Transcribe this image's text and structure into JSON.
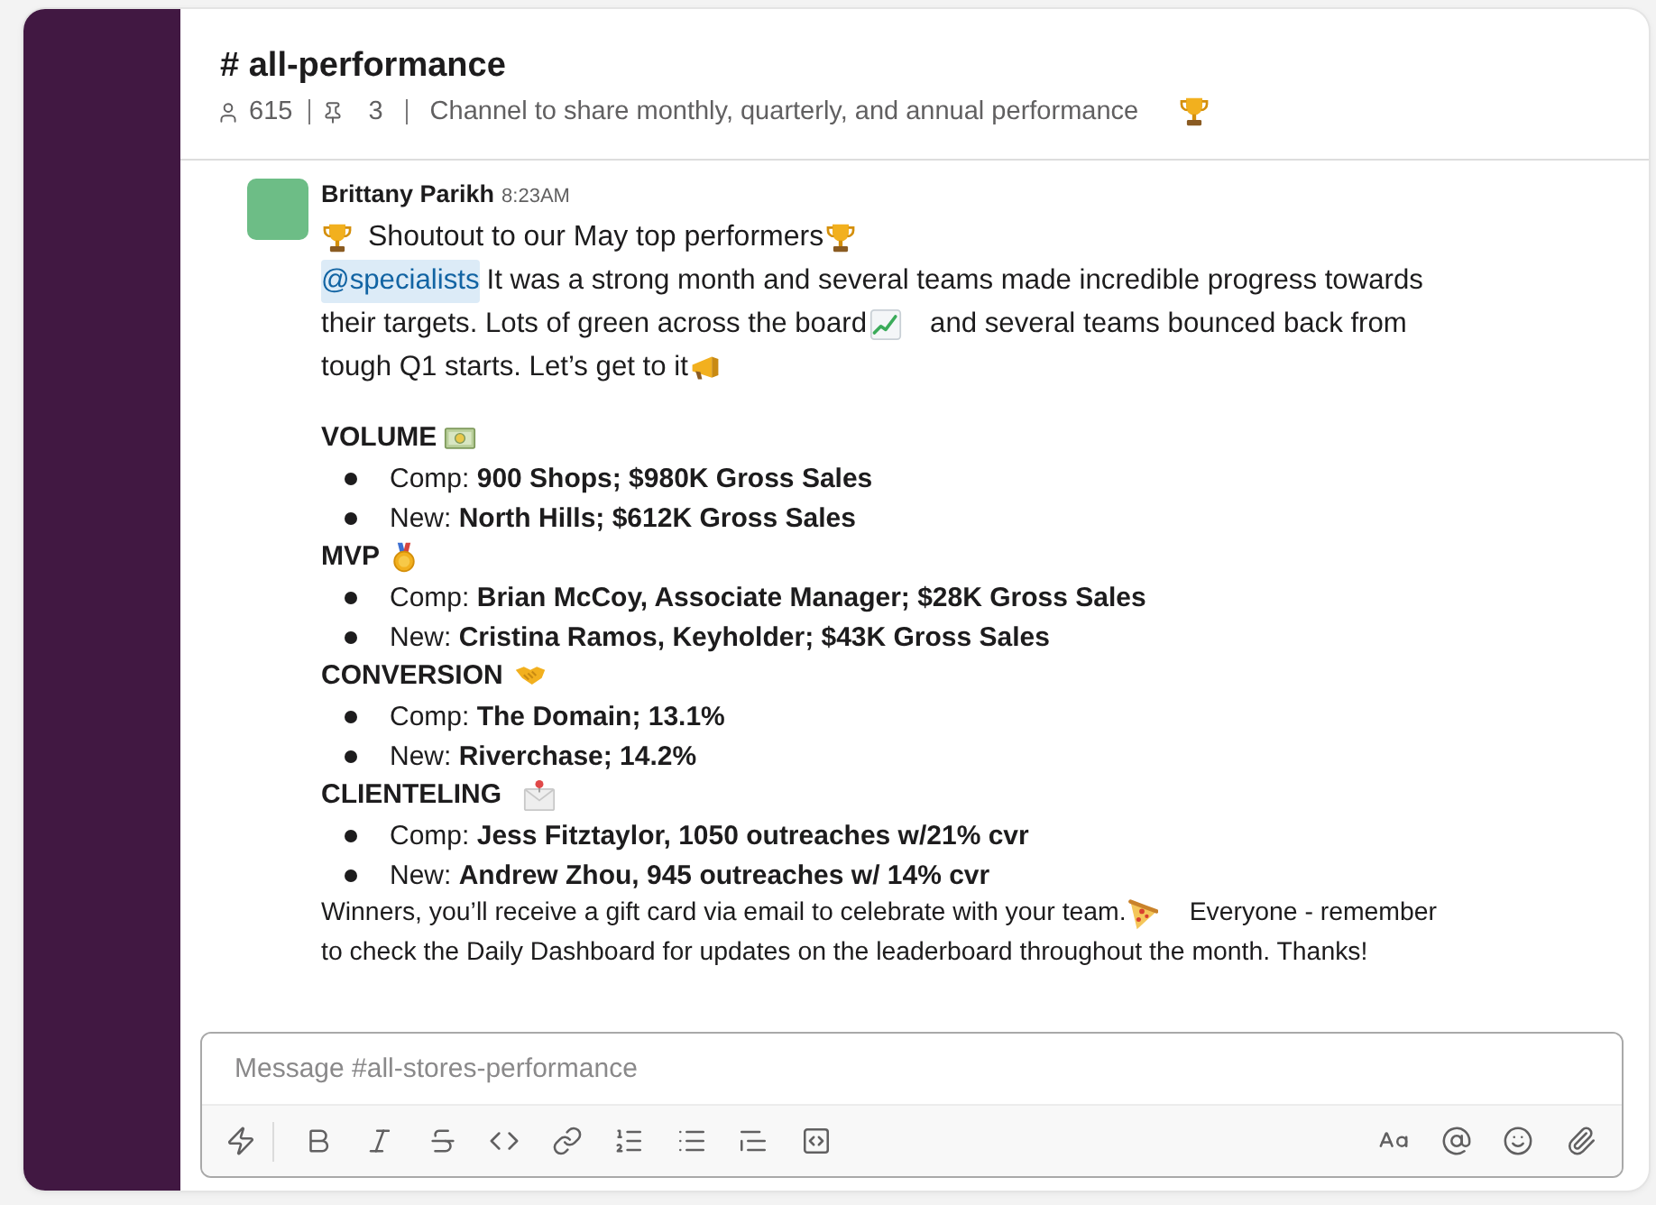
{
  "channel": {
    "title": "# all-performance",
    "members": "615",
    "pins": "3",
    "description": "Channel to share monthly, quarterly, and annual performance"
  },
  "message": {
    "author": "Brittany Parikh",
    "time": "8:23AM",
    "headline": "Shoutout to our May top performers",
    "intro": {
      "mention": "@specialists",
      "line_1": "It was a strong month and several teams made incredible progress towards",
      "line_2a": "their targets. Lots of green across the board",
      "line_2b": "and several teams bounced back from",
      "line_3": "tough Q1 starts. Let’s get to it"
    },
    "sections": [
      {
        "title": "VOLUME",
        "items": [
          "Comp: **900 Shops; $980K Gross Sales**",
          "New: **North Hills; $612K Gross Sales**"
        ]
      },
      {
        "title": "MVP",
        "items": [
          "Comp: **Brian McCoy, Associate Manager; $28K Gross Sales**",
          "New: **Cristina Ramos, Keyholder; $43K Gross Sales**"
        ]
      },
      {
        "title": "CONVERSION",
        "items": [
          "Comp: **The Domain; 13.1%**",
          "New: **Riverchase; 14.2%**"
        ]
      },
      {
        "title": "CLIENTELING",
        "items": [
          "Comp: **Jess Fitztaylor, 1050 outreaches w/21% cvr**",
          "New: **Andrew Zhou, 945 outreaches w/ 14% cvr**"
        ]
      }
    ],
    "closing": {
      "line_1a": "Winners, you’ll receive a gift card via email to celebrate with your team.",
      "line_1b": "Everyone - remember",
      "line_2": "to check the Daily Dashboard for updates on the leaderboard throughout the month. Thanks!"
    }
  },
  "composer": {
    "placeholder": "Message #all-stores-performance"
  }
}
